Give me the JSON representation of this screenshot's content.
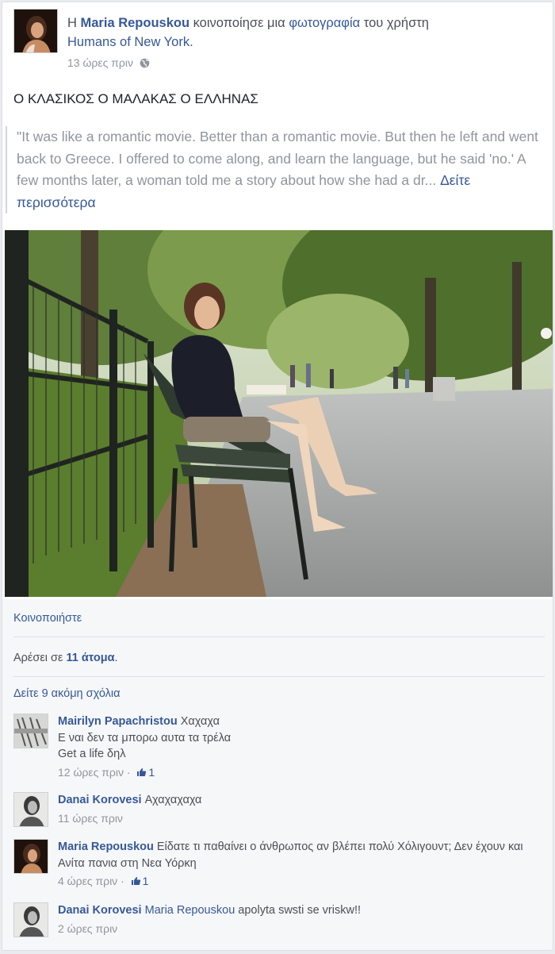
{
  "colors": {
    "link": "#365899",
    "meta": "#90949c",
    "text": "#1d2129",
    "footer_bg": "#f6f7f9"
  },
  "header": {
    "prefix": "Η",
    "author": "Maria Repouskou",
    "verb": " κοινοποίησε μια ",
    "photo_link": "φωτογραφία",
    "of_user": " του χρήστη",
    "page_name": "Humans of New York",
    "page_suffix": ".",
    "timestamp": "13 ώρες πριν",
    "privacy_icon": "globe-icon"
  },
  "post": {
    "status_text": "Ο ΚΛΑΣΙΚΟΣ Ο ΜΑΛΑΚΑΣ Ο ΕΛΛΗΝΑΣ",
    "quote_text": "\"It was like a romantic movie. Better than a romantic movie. But then he left and went back to Greece. I offered to come along, and learn the language, but he said 'no.' A few months later, a woman told me a story about how she had a dr...",
    "see_more": "Δείτε περισσότερα"
  },
  "actions": {
    "share": "Κοινοποιήστε",
    "likes_prefix": "Αρέσει σε ",
    "likes_count": "11 άτομα",
    "likes_suffix": ".",
    "more_comments": "Δείτε 9 ακόμη σχόλια"
  },
  "comments": [
    {
      "name": "Mairilyn Papachristou",
      "text": "Χαχαχα",
      "line2": "Ε ναι δεν τα μπορω αυτα τα τρέλα",
      "line3": "Get a life δηλ",
      "time": "12 ώρες πριν",
      "likes": "1"
    },
    {
      "name": "Danai Korovesi",
      "text": "Αχαχαχαχα",
      "time": "11 ώρες πριν"
    },
    {
      "name": "Maria Repouskou",
      "text": "Είδατε τι παθαίνει ο άνθρωπος αν βλέπει πολύ Χόλιγουντ; Δεν έχουν και Ανίτα πανια στη Νεα Υόρκη",
      "time": "4 ώρες πριν",
      "likes": "1"
    },
    {
      "name": "Danai Korovesi",
      "mention": "Maria Repouskou",
      "text": " apolyta swsti se vriskw!!",
      "time": "2 ώρες πριν"
    }
  ]
}
